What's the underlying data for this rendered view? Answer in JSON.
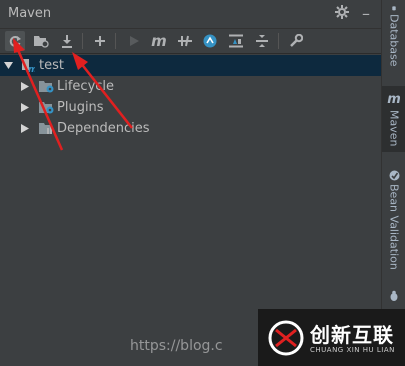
{
  "panel": {
    "title": "Maven"
  },
  "tree": {
    "root": {
      "label": "test"
    },
    "children": [
      {
        "label": "Lifecycle"
      },
      {
        "label": "Plugins"
      },
      {
        "label": "Dependencies"
      }
    ]
  },
  "right_strip": {
    "tabs": [
      {
        "label": "Database"
      },
      {
        "label": "Maven"
      },
      {
        "label": "Bean Validation"
      }
    ]
  },
  "watermark": {
    "text": "https://blog.c"
  },
  "badge": {
    "name": "创新互联",
    "sub": "CHUANG XIN HU LIAN"
  },
  "colors": {
    "accent": "#3592c4",
    "selection": "#0d293e",
    "annotation": "#e02020"
  }
}
